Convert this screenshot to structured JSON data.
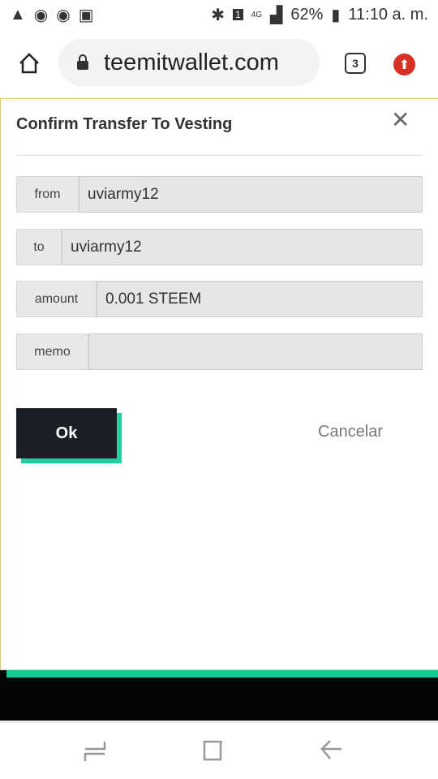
{
  "status_bar": {
    "battery": "62%",
    "time": "11:10 a. m.",
    "network": "4G",
    "sim": "1"
  },
  "browser": {
    "url": "teemitwallet.com",
    "tab_count": "3"
  },
  "dialog": {
    "title": "Confirm Transfer To Vesting",
    "fields": [
      {
        "label": "from",
        "value": "uviarmy12"
      },
      {
        "label": "to",
        "value": "uviarmy12"
      },
      {
        "label": "amount",
        "value": "0.001 STEEM"
      },
      {
        "label": "memo",
        "value": ""
      }
    ],
    "ok_label": "Ok",
    "cancel_label": "Cancelar"
  },
  "colors": {
    "accent": "#13c79a",
    "button": "#1a1f26"
  }
}
